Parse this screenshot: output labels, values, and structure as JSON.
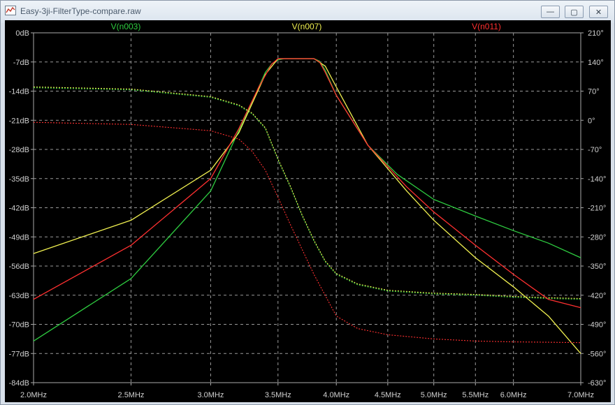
{
  "window": {
    "title": "Easy-3ji-FilterType-compare.raw"
  },
  "controls": {
    "minimize": "—",
    "maximize": "▢",
    "close": "✕"
  },
  "chart_data": {
    "type": "line",
    "x_scale": "log",
    "x_ticks": [
      2.0,
      2.5,
      3.0,
      3.5,
      4.0,
      4.5,
      5.0,
      5.5,
      6.0,
      7.0
    ],
    "x_tick_labels": [
      "2.0MHz",
      "2.5MHz",
      "3.0MHz",
      "3.5MHz",
      "4.0MHz",
      "4.5MHz",
      "5.0MHz",
      "5.5MHz",
      "6.0MHz",
      "7.0MHz"
    ],
    "xlim": [
      2.0,
      7.0
    ],
    "y_ticks": [
      0,
      -7,
      -14,
      -21,
      -28,
      -35,
      -42,
      -49,
      -56,
      -63,
      -70,
      -77,
      -84
    ],
    "y_tick_labels": [
      "0dB",
      "-7dB",
      "-14dB",
      "-21dB",
      "-28dB",
      "-35dB",
      "-42dB",
      "-49dB",
      "-56dB",
      "-63dB",
      "-70dB",
      "-77dB",
      "-84dB"
    ],
    "ylim": [
      -84,
      0
    ],
    "y2_ticks": [
      210,
      140,
      70,
      0,
      -70,
      -140,
      -210,
      -280,
      -350,
      -420,
      -490,
      -560,
      -630
    ],
    "y2_tick_labels": [
      "210°",
      "140°",
      "70°",
      "0°",
      "-70°",
      "-140°",
      "-210°",
      "-280°",
      "-350°",
      "-420°",
      "-490°",
      "-560°",
      "-630°"
    ],
    "y2lim": [
      -630,
      210
    ],
    "grid": true,
    "series": [
      {
        "name": "V(n003)",
        "color": "#2ecc40",
        "mag_x": [
          2.0,
          2.5,
          3.0,
          3.25,
          3.4,
          3.45,
          3.5,
          3.55,
          3.8,
          3.85,
          3.9,
          4.0,
          4.3,
          4.6,
          5.0,
          5.5,
          6.0,
          6.5,
          7.0
        ],
        "mag_y": [
          -74,
          -59,
          -38,
          -20,
          -9.5,
          -7.5,
          -6.5,
          -6.2,
          -6.2,
          -6.8,
          -9,
          -15,
          -27,
          -34,
          -40,
          -44,
          -47.5,
          -50.5,
          -54
        ],
        "phase_x": [
          2.0,
          2.5,
          3.0,
          3.2,
          3.3,
          3.4,
          3.5,
          3.6,
          3.7,
          3.8,
          3.9,
          4.0,
          4.2,
          4.5,
          5.0,
          5.5,
          6.0,
          6.5,
          7.0
        ],
        "phase_y": [
          78,
          73,
          55,
          35,
          15,
          -20,
          -95,
          -160,
          -230,
          -290,
          -340,
          -370,
          -395,
          -410,
          -417,
          -420,
          -425,
          -428,
          -430
        ]
      },
      {
        "name": "V(n007)",
        "color": "#f0f050",
        "mag_x": [
          2.0,
          2.5,
          3.0,
          3.2,
          3.4,
          3.5,
          3.8,
          3.9,
          4.0,
          4.3,
          4.7,
          5.0,
          5.5,
          6.0,
          6.5,
          7.0
        ],
        "mag_y": [
          -53,
          -45,
          -33,
          -24,
          -10,
          -6.2,
          -6.2,
          -8,
          -13,
          -27,
          -38,
          -45,
          -54,
          -61,
          -68,
          -77
        ],
        "phase_x": [
          2.0,
          2.5,
          3.0,
          3.2,
          3.3,
          3.4,
          3.5,
          3.6,
          3.7,
          3.8,
          3.9,
          4.0,
          4.2,
          4.5,
          5.0,
          5.5,
          6.0,
          6.5,
          7.0
        ],
        "phase_y": [
          80,
          75,
          57,
          37,
          17,
          -18,
          -93,
          -158,
          -228,
          -288,
          -338,
          -368,
          -393,
          -408,
          -415,
          -418,
          -423,
          -426,
          -428
        ]
      },
      {
        "name": "V(n011)",
        "color": "#ff3030",
        "mag_x": [
          2.0,
          2.5,
          3.0,
          3.2,
          3.35,
          3.45,
          3.5,
          3.8,
          3.85,
          3.9,
          4.0,
          4.3,
          4.7,
          5.0,
          5.5,
          6.0,
          6.5,
          7.0
        ],
        "mag_y": [
          -64,
          -51,
          -35,
          -23,
          -13,
          -7.5,
          -6.2,
          -6.2,
          -7,
          -9.5,
          -15,
          -27,
          -37,
          -43,
          -51,
          -58,
          -64,
          -66
        ],
        "phase_x": [
          2.0,
          2.5,
          3.0,
          3.2,
          3.3,
          3.4,
          3.5,
          3.6,
          3.8,
          4.0,
          4.2,
          4.5,
          5.0,
          5.5,
          6.0,
          6.5,
          7.0
        ],
        "phase_y": [
          -5,
          -10,
          -25,
          -45,
          -75,
          -120,
          -185,
          -250,
          -370,
          -470,
          -500,
          -515,
          -525,
          -530,
          -532,
          -533,
          -534
        ]
      }
    ]
  }
}
